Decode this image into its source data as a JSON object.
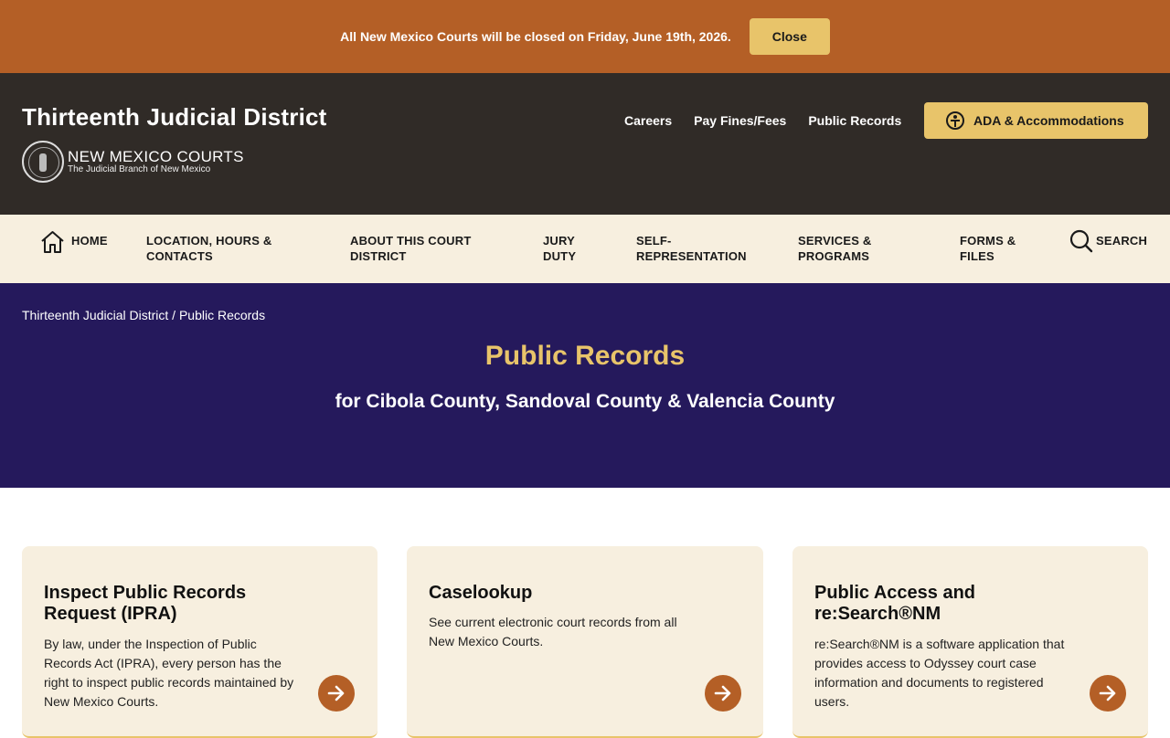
{
  "alert": {
    "message": "All New Mexico Courts will be closed on Friday, June 19th, 2026.",
    "close_label": "Close"
  },
  "header": {
    "site_title": "Thirteenth Judicial District",
    "logo_name": "NEW MEXICO COURTS",
    "logo_sub": "The Judicial Branch of New Mexico",
    "util_links": [
      "Careers",
      "Pay Fines/Fees",
      "Public Records"
    ],
    "ada_label": "ADA & Accommodations"
  },
  "nav": {
    "home": "HOME",
    "location": "LOCATION, HOURS & CONTACTS",
    "about": "ABOUT THIS COURT DISTRICT",
    "jury": "JURY DUTY",
    "self_rep": "SELF-REPRESENTATION",
    "services": "SERVICES & PROGRAMS",
    "forms": "FORMS & FILES",
    "search": "SEARCH"
  },
  "hero": {
    "breadcrumb": "Thirteenth Judicial District / Public Records",
    "title": "Public Records",
    "subtitle": "for Cibola County, Sandoval County & Valencia County"
  },
  "cards": [
    {
      "title": "Inspect Public Records Request (IPRA)",
      "desc": "By law, under the Inspection of Public Records Act (IPRA), every person has the right to inspect public records maintained by New Mexico Courts."
    },
    {
      "title": "Caselookup",
      "desc": "See current electronic court records from all New Mexico Courts."
    },
    {
      "title": "Public Access and re:Search®NM",
      "desc": "re:Search®NM is a software application that provides access to Odyssey court case information and documents to registered users."
    }
  ],
  "colors": {
    "alert_bg": "#b45f26",
    "header_bg": "#302b27",
    "accent_gold": "#e8c46a",
    "nav_bg": "#f7efdf",
    "hero_bg": "#25195c"
  }
}
